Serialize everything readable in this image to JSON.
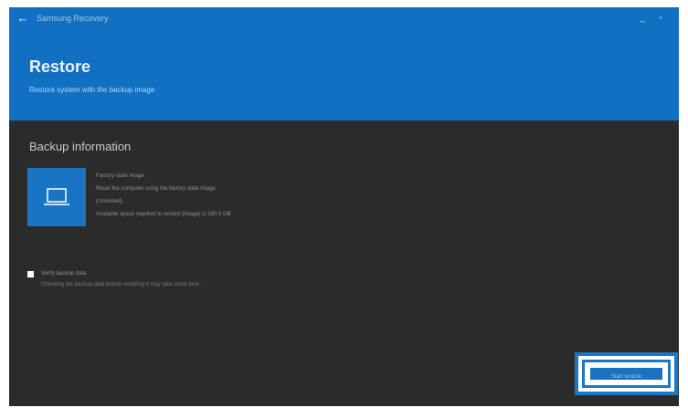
{
  "titlebar": {
    "back_icon": "←",
    "app_title": "Samsung Recovery",
    "minimize_glyph": "_",
    "maximize_glyph": "▫"
  },
  "header": {
    "title": "Restore",
    "subtitle": "Restore system with the backup image"
  },
  "backup": {
    "heading": "Backup information",
    "icon": "laptop-icon",
    "lines": [
      "Factory state image",
      "Reset the computer using the factory state image.",
      "(Unlimited)",
      "Available space required to restore (image) is 180.0 GB"
    ]
  },
  "options": {
    "checkbox_label": "Verify backup data",
    "checkbox_desc": "Checking the backup data before restoring it may take some time."
  },
  "actions": {
    "restore_label": "Start restore"
  },
  "colors": {
    "accent": "#1170c1",
    "background": "#2b2b2b",
    "highlight": "#1a78c9"
  }
}
